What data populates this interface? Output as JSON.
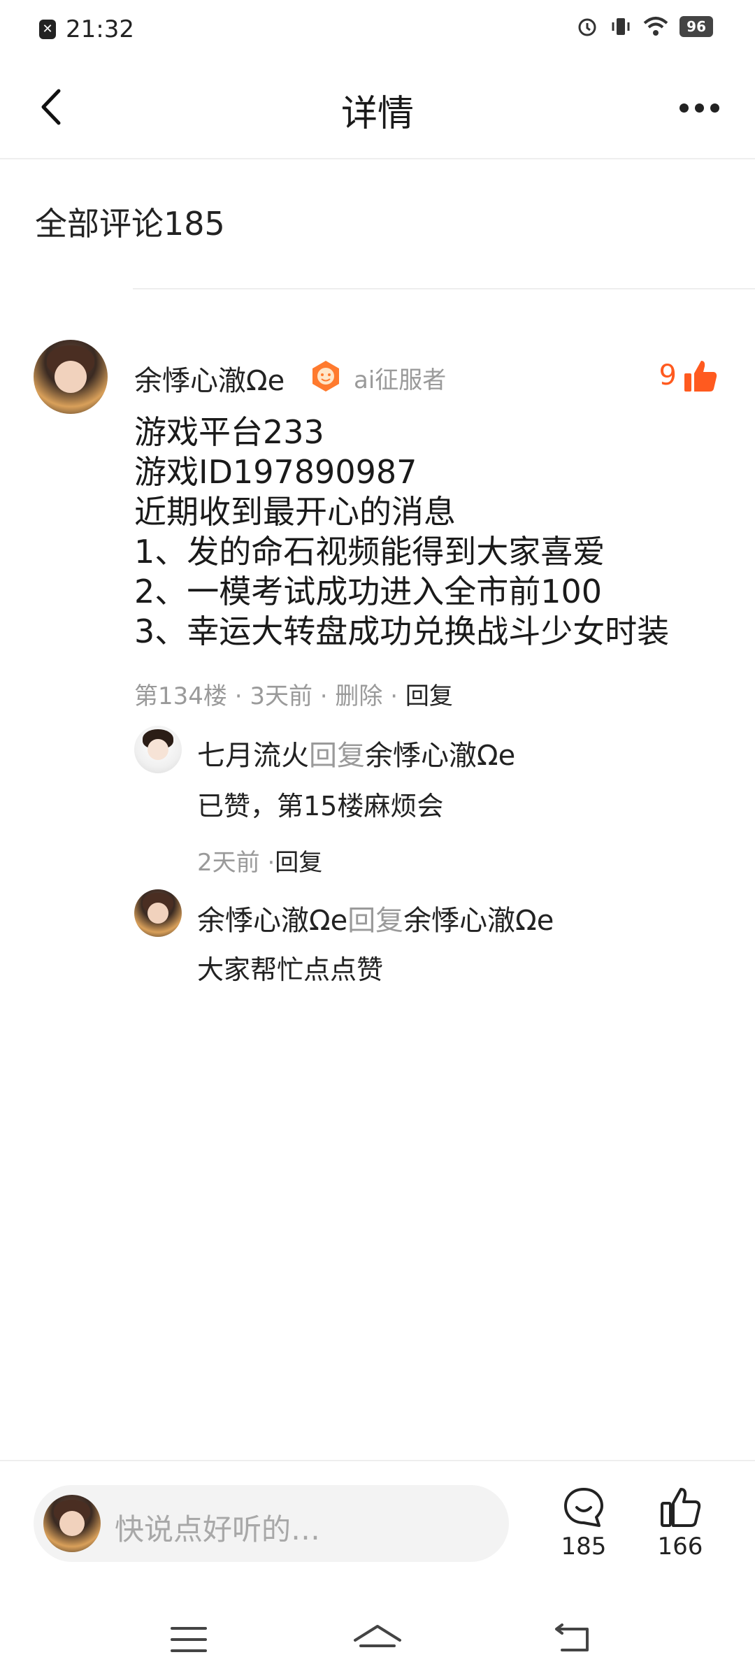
{
  "status_bar": {
    "time": "21:32",
    "notification_icon": "close-box-icon",
    "battery": "96",
    "icons": [
      "alarm-icon",
      "vibrate-icon",
      "wifi-icon",
      "battery-icon"
    ]
  },
  "header": {
    "back_icon": "chevron-left-icon",
    "title": "详情",
    "more_icon": "more-dots-icon"
  },
  "comments_section": {
    "title": "全部评论185"
  },
  "main_comment": {
    "username": "余悸心澈Ωe",
    "badge_label": "ai征服者",
    "like_count": "9",
    "lines": [
      "游戏平台233",
      "游戏ID197890987",
      "近期收到最开心的消息",
      "1、发的命石视频能得到大家喜爱",
      "2、一模考试成功进入全市前100",
      "3、幸运大转盘成功兑换战斗少女时装"
    ],
    "meta": {
      "floor": "第134楼",
      "sep1": " · ",
      "time": "3天前",
      "sep2": " · ",
      "delete": "删除",
      "sep3": " · ",
      "reply": "回复"
    }
  },
  "replies": [
    {
      "username": "七月流火",
      "reply_word": "回复",
      "target": "余悸心澈Ωe",
      "text": "已赞，第15楼麻烦会",
      "time": "2天前",
      "sep": " ·",
      "reply": "回复"
    },
    {
      "username": "余悸心澈Ωe",
      "reply_word": "回复",
      "target": "余悸心澈Ωe",
      "text": "大家帮忙点点赞"
    }
  ],
  "bottom_bar": {
    "input_placeholder": "快说点好听的…",
    "comment_count": "185",
    "like_count": "166"
  },
  "colors": {
    "accent": "#ff5a1f",
    "muted": "#9a9a9a",
    "text": "#1a1a1a"
  }
}
